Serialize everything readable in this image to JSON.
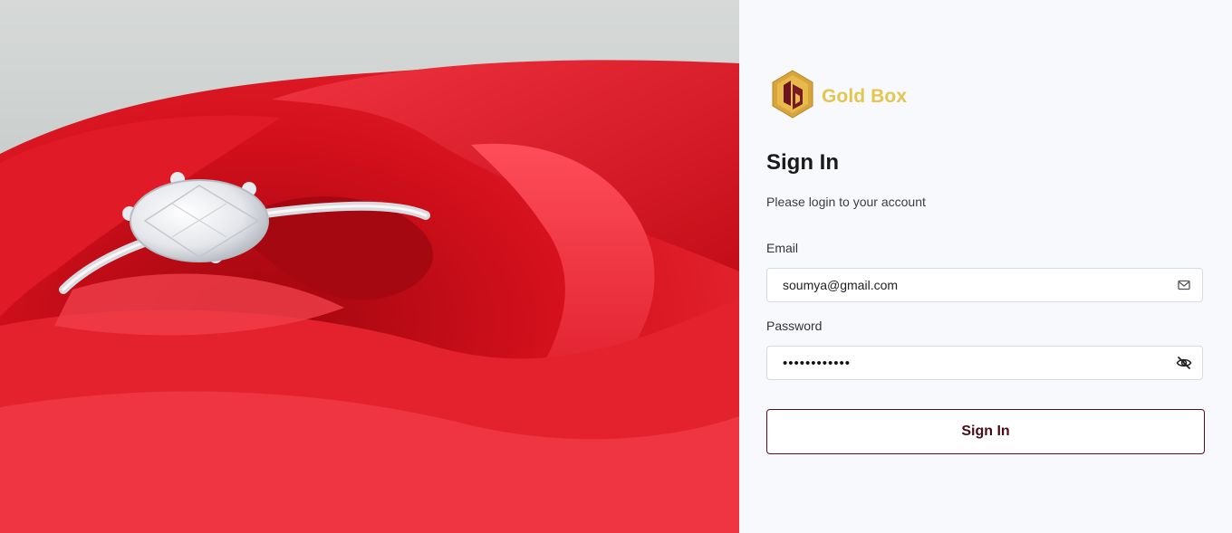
{
  "brand": {
    "name": "Gold Box",
    "logo_icon": "gold-box-hexagon-logo",
    "name_color": "#e3c64f"
  },
  "hero": {
    "image": "diamond ring resting inside a red rose (photo)"
  },
  "login": {
    "title": "Sign In",
    "subtitle": "Please login to your account",
    "email_label": "Email",
    "email_value": "soumya@gmail.com",
    "email_icon": "mail-icon",
    "password_label": "Password",
    "password_masked": "••••••••••••",
    "password_icon": "eye-off-icon",
    "submit_label": "Sign In",
    "accent_color": "#5a0f1c"
  }
}
